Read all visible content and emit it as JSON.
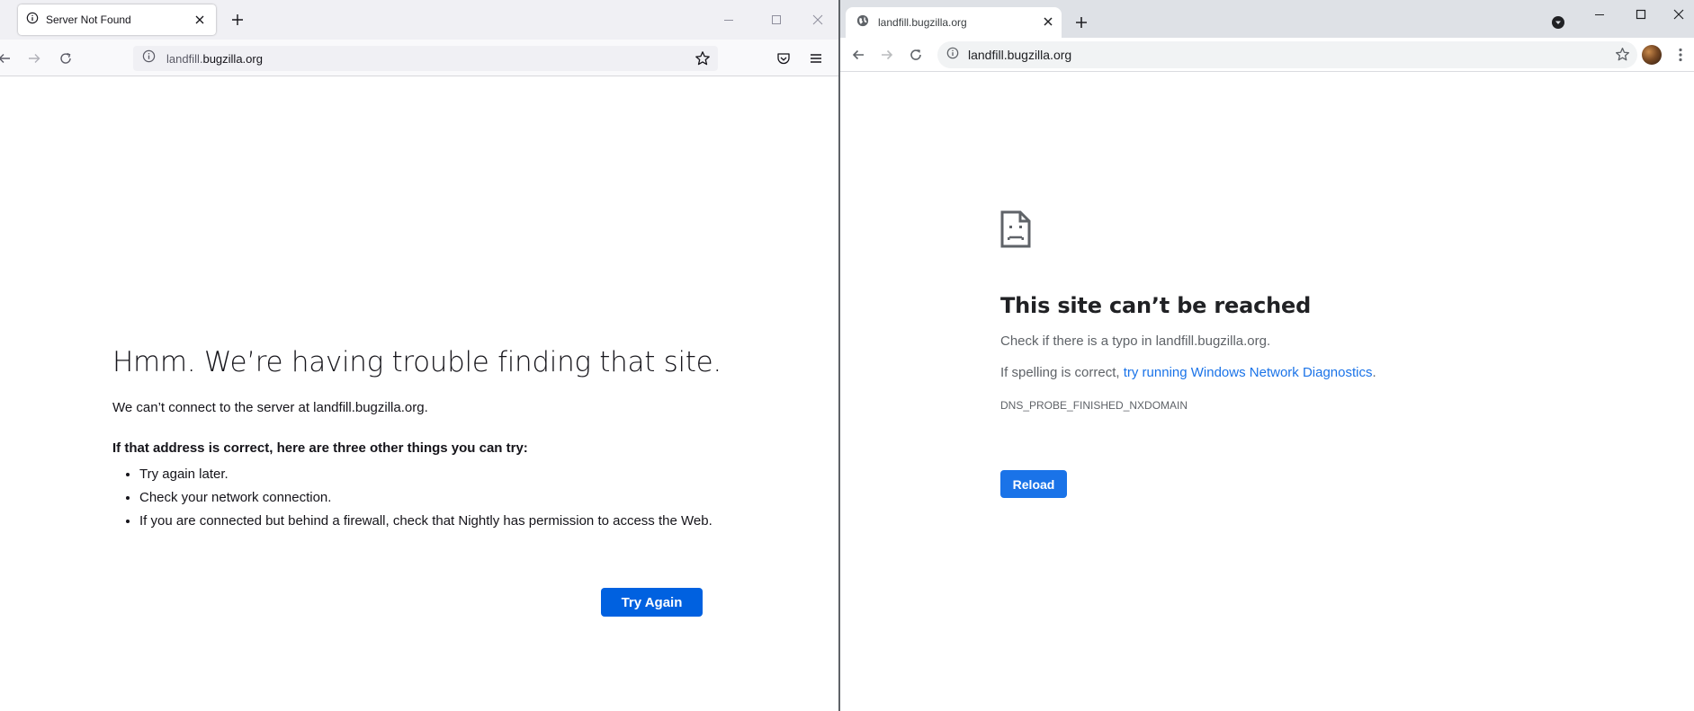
{
  "firefox": {
    "tab_title": "Server Not Found",
    "url_prefix": "landfill.",
    "url_domain": "bugzilla.org",
    "heading": "Hmm. We’re having trouble finding that site.",
    "lead": "We can’t connect to the server at landfill.bugzilla.org.",
    "subheading": "If that address is correct, here are three other things you can try:",
    "tips": [
      "Try again later.",
      "Check your network connection.",
      "If you are connected but behind a firewall, check that Nightly has permission to access the Web."
    ],
    "try_again_label": "Try Again",
    "accent": "#0061e0"
  },
  "chrome": {
    "tab_title": "landfill.bugzilla.org",
    "url": "landfill.bugzilla.org",
    "heading": "This site can’t be reached",
    "para1": "Check if there is a typo in landfill.bugzilla.org.",
    "para2_prefix": "If spelling is correct, ",
    "para2_link": "try running Windows Network Diagnostics",
    "para2_suffix": ".",
    "error_code": "DNS_PROBE_FINISHED_NXDOMAIN",
    "reload_label": "Reload",
    "accent": "#1a73e8"
  }
}
